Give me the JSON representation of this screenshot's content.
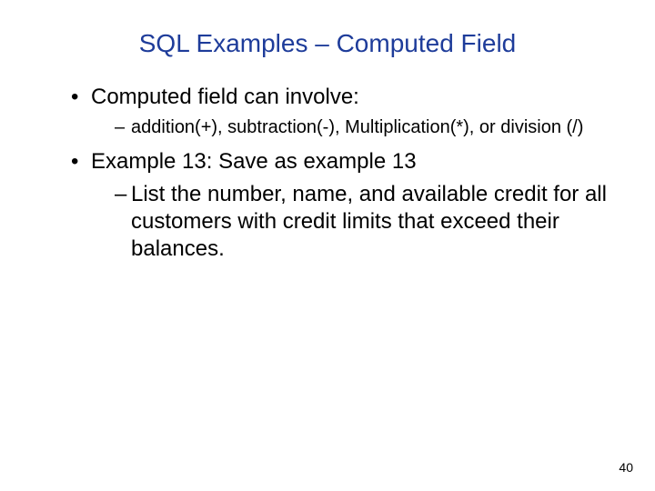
{
  "title": "SQL Examples – Computed Field",
  "bullets": [
    {
      "text": "Computed field can involve:",
      "sub": [
        {
          "text": "addition(+), subtraction(-), Multiplication(*), or division (/)",
          "size": "small"
        }
      ]
    },
    {
      "text": "Example 13: Save as example 13",
      "sub": [
        {
          "text": "List the number, name, and available credit for all customers with credit limits that exceed their balances.",
          "size": "large"
        }
      ]
    }
  ],
  "page_number": "40"
}
